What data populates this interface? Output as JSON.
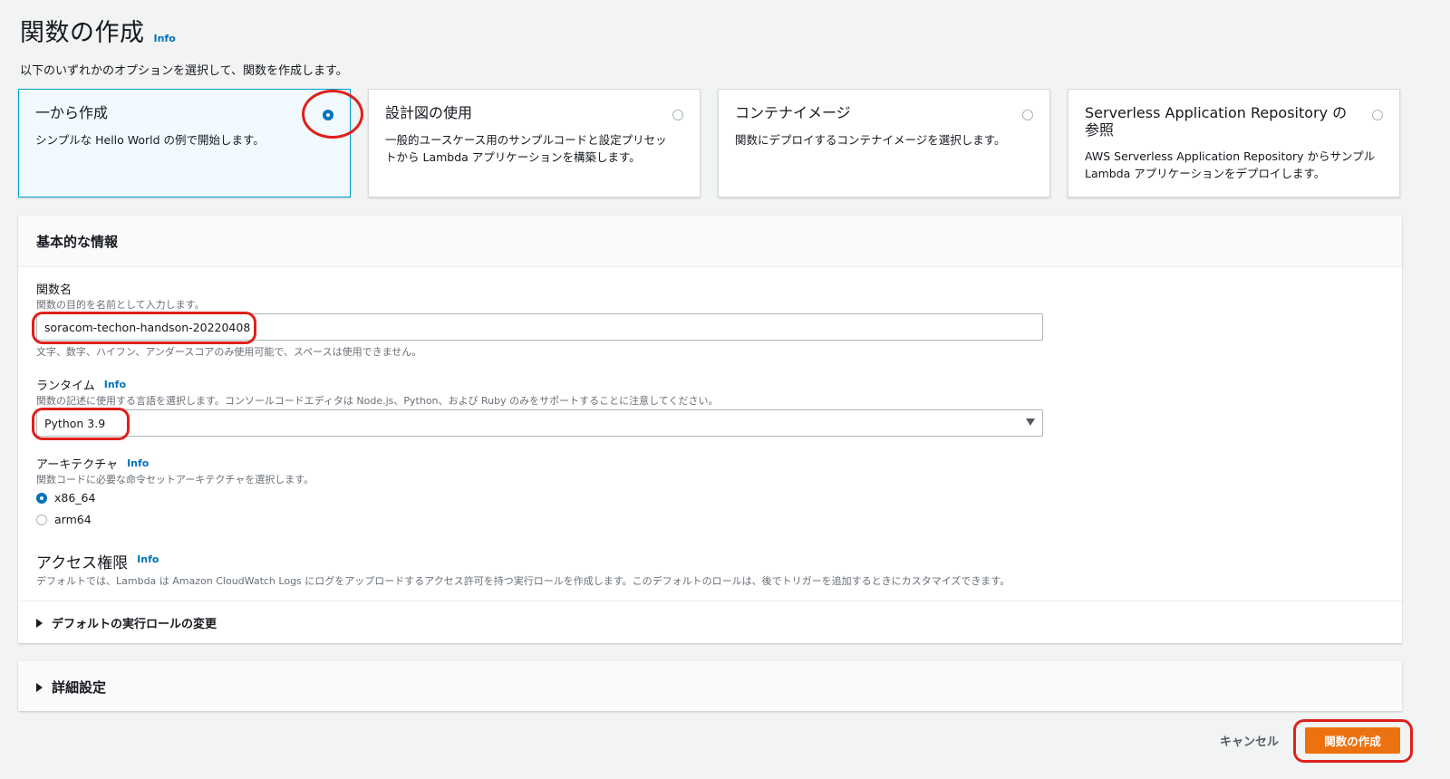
{
  "page": {
    "title": "関数の作成",
    "info": "Info",
    "subtitle": "以下のいずれかのオプションを選択して、関数を作成します。"
  },
  "options": [
    {
      "title": "一から作成",
      "description": "シンプルな Hello World の例で開始します。",
      "selected": true
    },
    {
      "title": "設計図の使用",
      "description": "一般的ユースケース用のサンプルコードと設定プリセットから Lambda アプリケーションを構築します。",
      "selected": false
    },
    {
      "title": "コンテナイメージ",
      "description": "関数にデプロイするコンテナイメージを選択します。",
      "selected": false
    },
    {
      "title": "Serverless Application Repository の参照",
      "description": "AWS Serverless Application Repository からサンプル Lambda アプリケーションをデプロイします。",
      "selected": false
    }
  ],
  "basic": {
    "header": "基本的な情報",
    "function_name": {
      "label": "関数名",
      "description": "関数の目的を名前として入力します。",
      "value": "soracom-techon-handson-20220408",
      "hint": "文字、数字、ハイフン、アンダースコアのみ使用可能で、スペースは使用できません。"
    },
    "runtime": {
      "label": "ランタイム",
      "info": "Info",
      "description": "関数の記述に使用する言語を選択します。コンソールコードエディタは Node.js、Python、および Ruby のみをサポートすることに注意してください。",
      "value": "Python 3.9"
    },
    "architecture": {
      "label": "アーキテクチャ",
      "info": "Info",
      "description": "関数コードに必要な命令セットアーキテクチャを選択します。",
      "options": [
        {
          "label": "x86_64",
          "selected": true
        },
        {
          "label": "arm64",
          "selected": false
        }
      ]
    },
    "permissions": {
      "title": "アクセス権限",
      "info": "Info",
      "description": "デフォルトでは、Lambda は Amazon CloudWatch Logs にログをアップロードするアクセス許可を持つ実行ロールを作成します。このデフォルトのロールは、後でトリガーを追加するときにカスタマイズできます。",
      "expander": "デフォルトの実行ロールの変更"
    }
  },
  "advanced": {
    "label": "詳細設定"
  },
  "footer": {
    "cancel": "キャンセル",
    "create": "関数の作成"
  },
  "colors": {
    "accent": "#0073bb",
    "primary_button": "#ec7211",
    "highlight": "#e0201b",
    "selected_bg": "#f1faff"
  }
}
